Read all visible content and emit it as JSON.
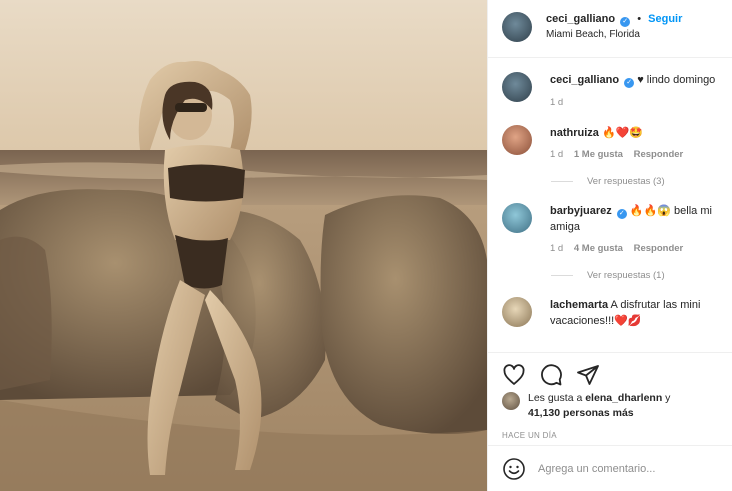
{
  "post": {
    "author": "ceci_galliano",
    "follow_label": "Seguir",
    "location": "Miami Beach, Florida",
    "dot": "•"
  },
  "caption": {
    "username": "ceci_galliano",
    "text": "♥ lindo domingo",
    "time": "1 d"
  },
  "comments": [
    {
      "username": "nathruiza",
      "text": "🔥❤️🤩",
      "time": "1 d",
      "likes": "1 Me gusta",
      "reply": "Responder",
      "view_replies": "Ver respuestas (3)"
    },
    {
      "username": "barbyjuarez",
      "text": "🔥🔥😱 bella mi amiga",
      "time": "1 d",
      "likes": "4 Me gusta",
      "reply": "Responder",
      "view_replies": "Ver respuestas (1)"
    },
    {
      "username": "lachemarta",
      "text": "A disfrutar las mini vacaciones!!!❤️💋"
    }
  ],
  "likes": {
    "prefix": "Les gusta a",
    "user": "elena_dharlenn",
    "connector": "y",
    "count": "41,130 personas más"
  },
  "timestamp": "HACE UN DÍA",
  "comment_input": {
    "placeholder": "Agrega un comentario..."
  },
  "icons": {
    "like": "heart-icon",
    "comment": "comment-icon",
    "share": "share-icon",
    "emoji": "emoji-icon",
    "verified": "verified-badge-icon"
  },
  "colors": {
    "accent": "#0095f6",
    "verified": "#3897f0",
    "muted": "#8e8e8e",
    "text": "#262626",
    "photo_tone": "#d8c3a3"
  }
}
